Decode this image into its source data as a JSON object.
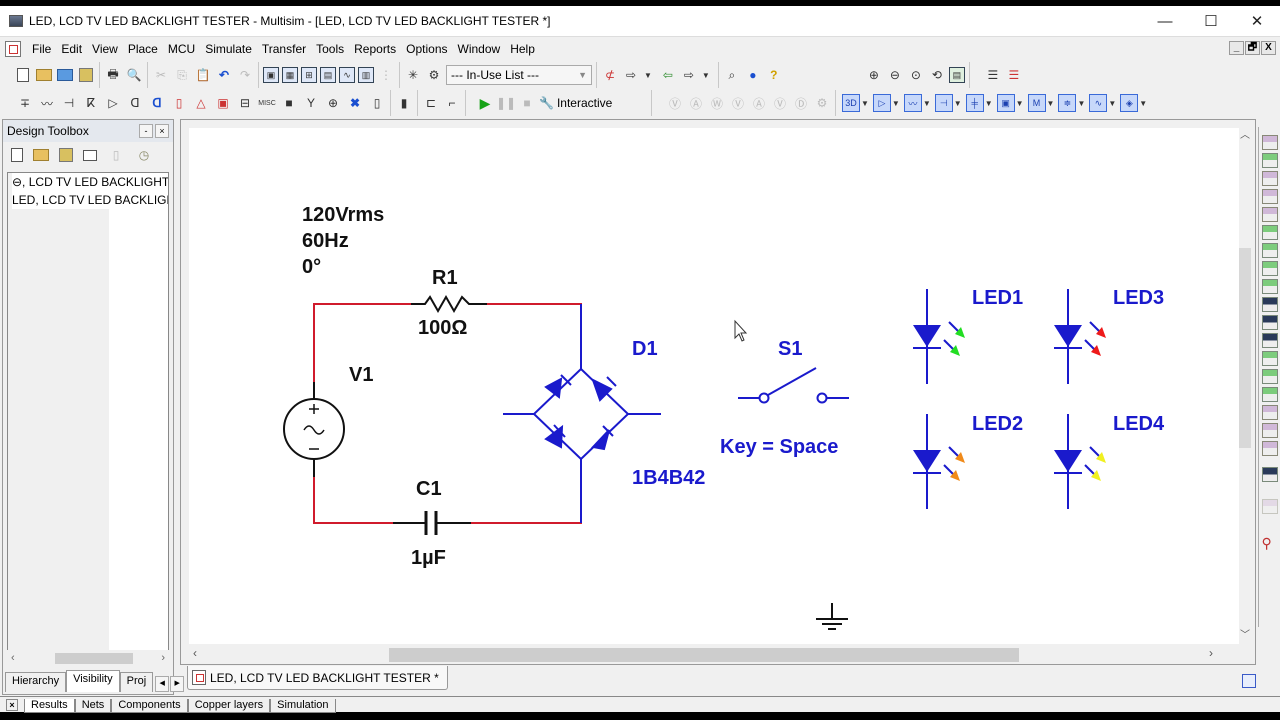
{
  "window": {
    "title": "LED, LCD TV LED BACKLIGHT TESTER - Multisim - [LED, LCD TV LED BACKLIGHT TESTER *]",
    "controls": {
      "minimize": "—",
      "maximize": "☐",
      "close": "✕"
    }
  },
  "menu": {
    "items": [
      {
        "label": "File"
      },
      {
        "label": "Edit"
      },
      {
        "label": "View"
      },
      {
        "label": "Place"
      },
      {
        "label": "MCU"
      },
      {
        "label": "Simulate"
      },
      {
        "label": "Transfer"
      },
      {
        "label": "Tools"
      },
      {
        "label": "Reports"
      },
      {
        "label": "Options"
      },
      {
        "label": "Window"
      },
      {
        "label": "Help"
      }
    ],
    "mdi_controls": {
      "minimize": "_",
      "restore": "🗗",
      "close": "X"
    }
  },
  "toolbar": {
    "in_use_list": "--- In-Use List ---",
    "interactive_label": "Interactive",
    "component_icons": [
      "source-icon",
      "resistor-icon",
      "diode-icon",
      "transistor-icon",
      "analog-icon",
      "ttl-icon",
      "cmos-icon",
      "mcu-icon",
      "mixed-icon",
      "indicator-icon",
      "power-icon",
      "misc-icon",
      "advanced-peripherals-icon",
      "rf-icon",
      "electromechanical-icon",
      "ni-component-icon",
      "connector-icon",
      "hierarchical-block-icon",
      "bus-icon"
    ],
    "misc_labels": {
      "misc": "MISC",
      "3d": "3D",
      "m": "M"
    }
  },
  "design_toolbox": {
    "title": "Design Toolbox",
    "tree": [
      "⊖, LCD TV LED BACKLIGHT TESTER",
      "LED, LCD TV LED BACKLIGHT TESTER"
    ],
    "tabs": [
      {
        "label": "Hierarchy",
        "active": false
      },
      {
        "label": "Visibility",
        "active": true
      },
      {
        "label": "Proj",
        "active": false
      }
    ]
  },
  "document_tab": {
    "label": "LED, LCD TV LED BACKLIGHT TESTER *"
  },
  "output_tabs": [
    {
      "label": "Results",
      "active": true
    },
    {
      "label": "Nets"
    },
    {
      "label": "Components"
    },
    {
      "label": "Copper layers"
    },
    {
      "label": "Simulation"
    }
  ],
  "schematic": {
    "source": {
      "ref": "V1",
      "voltage": "120Vrms",
      "frequency": "60Hz",
      "phase": "0°"
    },
    "resistor": {
      "ref": "R1",
      "value": "100Ω"
    },
    "capacitor": {
      "ref": "C1",
      "value": "1µF"
    },
    "bridge": {
      "ref": "D1",
      "model": "1B4B42"
    },
    "switch": {
      "ref": "S1",
      "key": "Key = Space"
    },
    "leds": [
      {
        "ref": "LED1",
        "color": "#22dd22"
      },
      {
        "ref": "LED2",
        "color": "#f08a1a"
      },
      {
        "ref": "LED3",
        "color": "#ee1a1a"
      },
      {
        "ref": "LED4",
        "color": "#f0f020"
      }
    ],
    "colors": {
      "wire": "#d01b2c",
      "component": "#1a1acc",
      "label": "#111111"
    }
  }
}
